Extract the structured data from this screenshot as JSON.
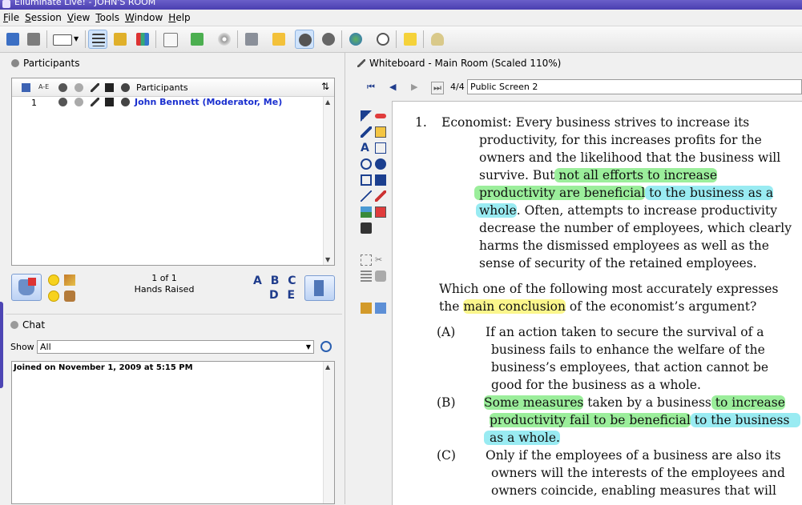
{
  "window": {
    "title": "Elluminate Live! - JOHN'S ROOM"
  },
  "menu": [
    "File",
    "Session",
    "View",
    "Tools",
    "Window",
    "Help"
  ],
  "participants": {
    "panel_title": "Participants",
    "column_label": "Participants",
    "rows": [
      {
        "number": "1",
        "name": "John Bennett (Moderator, Me)"
      }
    ],
    "hands_count": "1 of 1",
    "hands_label": "Hands Raised",
    "abc_line1": "A B C",
    "abc_line2": "D E"
  },
  "chat": {
    "panel_title": "Chat",
    "show_label": "Show",
    "show_value": "All",
    "messages": [
      "Joined on November 1, 2009 at 5:15 PM"
    ]
  },
  "whiteboard": {
    "panel_title": "Whiteboard - Main Room (Scaled 110%)",
    "page_indicator": "4/4",
    "screen_name": "Public Screen 2",
    "question_number": "1.",
    "p1": [
      "Economist: Every business strives to increase its",
      "productivity, for this increases profits for the",
      "owners and the likelihood that the business will"
    ],
    "p1_l4a": "survive. But",
    "p1_l4b": " not all efforts to increase",
    "p1_l5a": "productivity are beneficial",
    "p1_l5b": " to the business as a",
    "p1_l6a": "whole",
    "p1_l6b": ". Often, attempts to increase productivity",
    "p1_rest": [
      "decrease the number of employees, which clearly",
      "harms the dismissed employees as well as the",
      "sense of security of the retained employees."
    ],
    "stem_l1": "Which one of the following most accurately expresses",
    "stem_l2a": "the ",
    "stem_l2b": "main conclusion",
    "stem_l2c": " of the economist’s argument?",
    "a_label": "(A)",
    "a_lines": [
      "If an action taken to secure the survival of a",
      "business fails to enhance the welfare of the",
      "business’s employees, that action cannot be",
      "good for the business as a whole."
    ],
    "b_label": "(B)",
    "b_l1a": "Some measures",
    "b_l1b": " taken by a business",
    "b_l1c": " to increase",
    "b_l2a": "productivity fail to be beneficial",
    "b_l2b": " to the business",
    "b_l3": "as a whole.",
    "c_label": "(C)",
    "c_lines": [
      "Only if the employees of a business are also its",
      "owners will the interests of the employees and",
      "owners coincide, enabling measures that will"
    ]
  },
  "colors": {
    "title_bar": "#4a3fb0",
    "moderator_name": "#1a2fcf",
    "highlight_green": "#7ae87a",
    "highlight_cyan": "#6ee2ec",
    "highlight_yellow": "#faf578"
  }
}
